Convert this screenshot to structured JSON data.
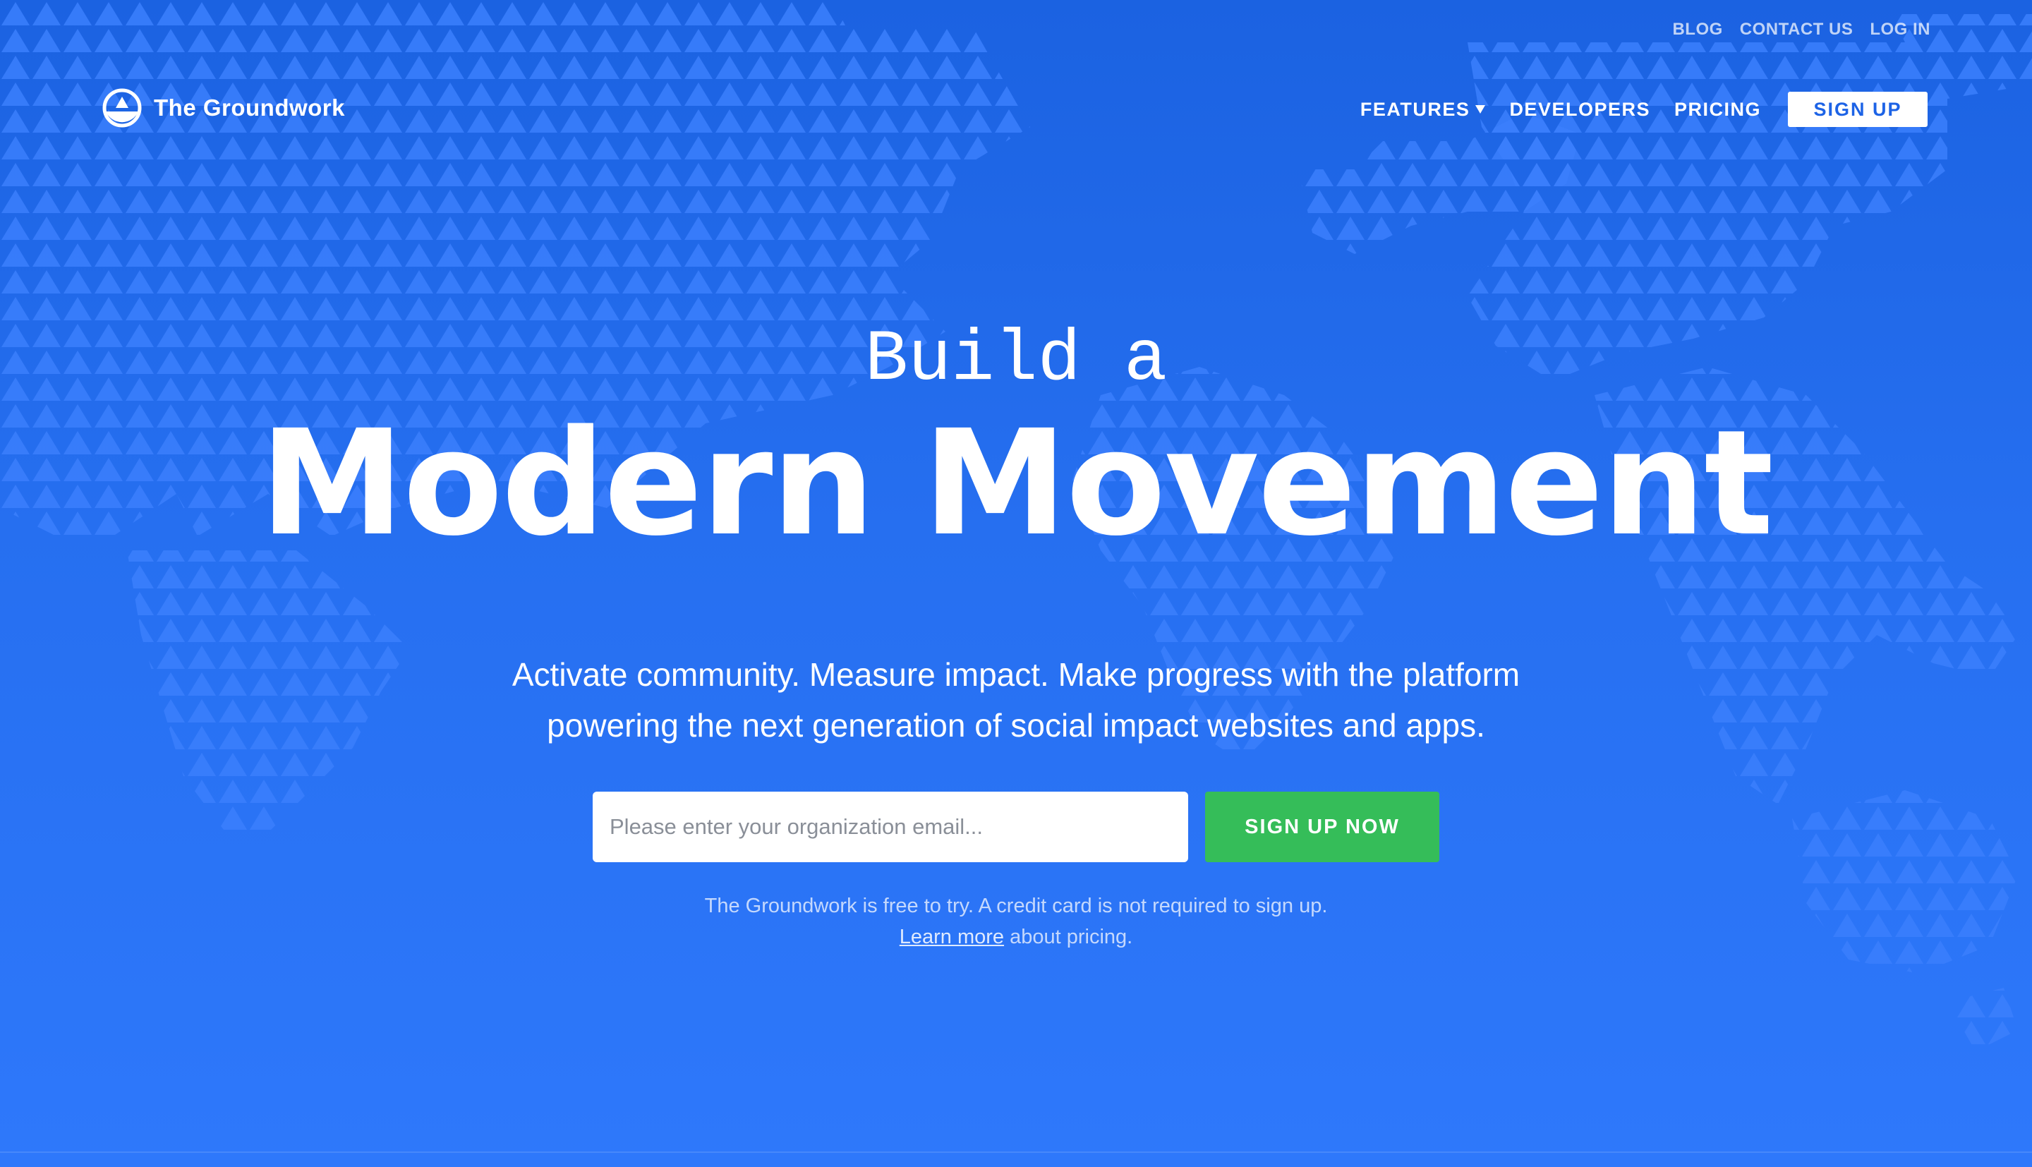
{
  "brand": {
    "name": "The Groundwork"
  },
  "utility_nav": {
    "blog": "BLOG",
    "contact": "CONTACT US",
    "login": "LOG IN"
  },
  "main_nav": {
    "features": "FEATURES",
    "developers": "DEVELOPERS",
    "pricing": "PRICING",
    "signup": "SIGN UP"
  },
  "hero": {
    "eyebrow": "Build a",
    "headline": "Modern Movement",
    "subhead_line1": "Activate community. Measure impact. Make progress with the platform",
    "subhead_line2": "powering the next generation of social impact websites and apps."
  },
  "form": {
    "email_placeholder": "Please enter your organization email...",
    "cta_label": "SIGN UP NOW"
  },
  "fineprint": {
    "line1": "The Groundwork is free to try. A credit card is not required to sign up.",
    "learn_more_link": "Learn more",
    "line2_suffix": " about pricing."
  },
  "colors": {
    "background_top": "#1b62e1",
    "background_bottom": "#2e78fb",
    "map_triangle": "#3b7ffd",
    "cta_green": "#35bd59",
    "signup_text_blue": "#1d63e6"
  },
  "icons": {
    "logo": "groundwork-logo-icon",
    "features_dropdown": "caret-down-icon",
    "background": "world-map-triangle-pattern"
  }
}
